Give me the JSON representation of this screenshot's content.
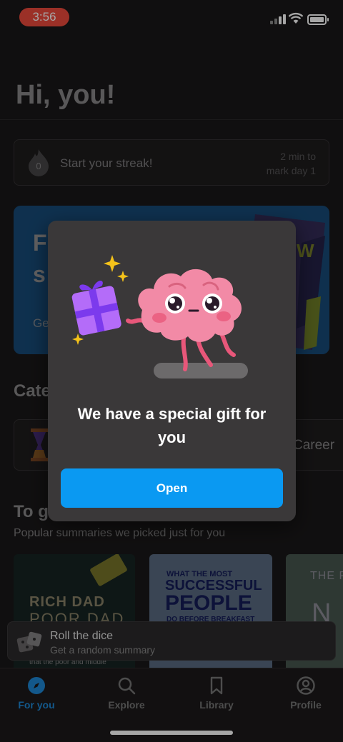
{
  "status_bar": {
    "time": "3:56"
  },
  "greeting": "Hi, you!",
  "streak": {
    "count": "0",
    "text": "Start your streak!",
    "meta_line1": "2 min to",
    "meta_line2": "mark day 1"
  },
  "promo": {
    "title": "F\ns",
    "subtitle": "Ge",
    "book_letter": "W"
  },
  "categories": {
    "heading": "Cate",
    "career_label": "Career"
  },
  "picked": {
    "heading": "To g",
    "subtitle": "Popular summaries we picked just for you"
  },
  "books": [
    {
      "line1": "RICH DAD",
      "line2": "POOR DAD",
      "line3": "that the poor and middle"
    },
    {
      "line1": "WHAT THE MOST",
      "line2": "SUCCESSFUL",
      "line3": "PEOPLE",
      "line4": "DO BEFORE BREAKFAST"
    },
    {
      "line1": "THE P",
      "line2": "N"
    }
  ],
  "dice": {
    "title": "Roll the dice",
    "subtitle": "Get a random summary"
  },
  "tabs": [
    {
      "label": "For you",
      "icon": "compass-icon",
      "active": true
    },
    {
      "label": "Explore",
      "icon": "search-icon",
      "active": false
    },
    {
      "label": "Library",
      "icon": "bookmark-icon",
      "active": false
    },
    {
      "label": "Profile",
      "icon": "profile-icon",
      "active": false
    }
  ],
  "modal": {
    "title": "We have a special gift for you",
    "button_label": "Open"
  },
  "colors": {
    "accent": "#0a99f2",
    "active_tab": "#1e88d6",
    "alert_time": "#ef4a3c",
    "promo": "#1677c9"
  }
}
